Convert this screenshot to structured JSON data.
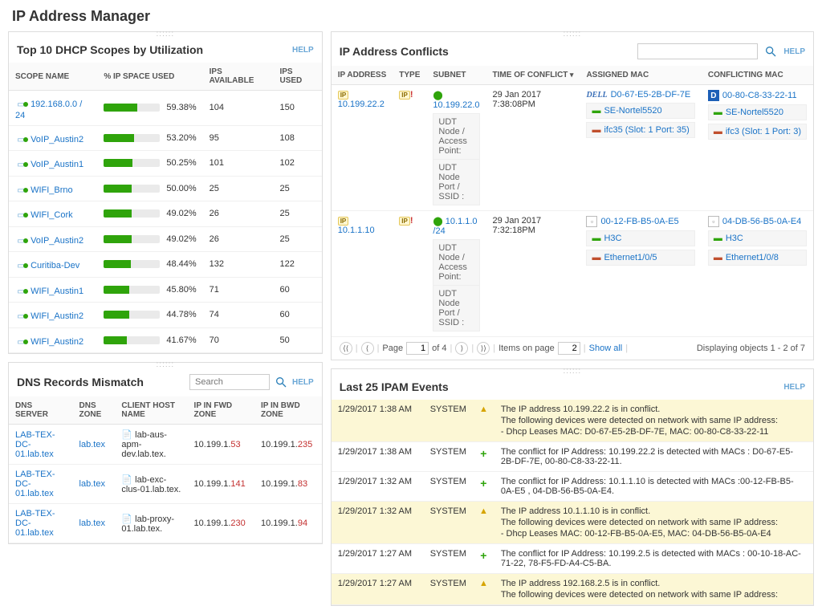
{
  "page_title": "IP Address Manager",
  "help_label": "HELP",
  "dhcp": {
    "title": "Top 10 DHCP Scopes by Utilization",
    "cols": {
      "name": "SCOPE NAME",
      "used": "% IP SPACE USED",
      "avail": "IPS AVAILABLE",
      "ipsused": "IPS USED"
    },
    "rows": [
      {
        "name": "192.168.0.0 / 24",
        "pct": 59.38,
        "pct_label": "59.38%",
        "avail": 104,
        "used": 150
      },
      {
        "name": "VoIP_Austin2",
        "pct": 53.2,
        "pct_label": "53.20%",
        "avail": 95,
        "used": 108
      },
      {
        "name": "VoIP_Austin1",
        "pct": 50.25,
        "pct_label": "50.25%",
        "avail": 101,
        "used": 102
      },
      {
        "name": "WIFI_Brno",
        "pct": 50.0,
        "pct_label": "50.00%",
        "avail": 25,
        "used": 25
      },
      {
        "name": "WIFI_Cork",
        "pct": 49.02,
        "pct_label": "49.02%",
        "avail": 26,
        "used": 25
      },
      {
        "name": "VoIP_Austin2",
        "pct": 49.02,
        "pct_label": "49.02%",
        "avail": 26,
        "used": 25
      },
      {
        "name": "Curitiba-Dev",
        "pct": 48.44,
        "pct_label": "48.44%",
        "avail": 132,
        "used": 122
      },
      {
        "name": "WIFI_Austin1",
        "pct": 45.8,
        "pct_label": "45.80%",
        "avail": 71,
        "used": 60
      },
      {
        "name": "WIFI_Austin2",
        "pct": 44.78,
        "pct_label": "44.78%",
        "avail": 74,
        "used": 60
      },
      {
        "name": "WIFI_Austin2",
        "pct": 41.67,
        "pct_label": "41.67%",
        "avail": 70,
        "used": 50
      }
    ]
  },
  "dns": {
    "title": "DNS Records Mismatch",
    "search_placeholder": "Search",
    "cols": {
      "server": "DNS SERVER",
      "zone": "DNS ZONE",
      "host": "CLIENT HOST NAME",
      "fwd": "IP IN FWD ZONE",
      "bwd": "IP IN BWD ZONE"
    },
    "rows": [
      {
        "server": "LAB-TEX-DC-01.lab.tex",
        "zone": "lab.tex",
        "host": "lab-aus-apm-dev.lab.tex.",
        "fwd_pre": "10.199.1.",
        "fwd_suf": "53",
        "bwd_pre": "10.199.1.",
        "bwd_suf": "235"
      },
      {
        "server": "LAB-TEX-DC-01.lab.tex",
        "zone": "lab.tex",
        "host": "lab-exc-clus-01.lab.tex.",
        "fwd_pre": "10.199.1.",
        "fwd_suf": "141",
        "bwd_pre": "10.199.1.",
        "bwd_suf": "83"
      },
      {
        "server": "LAB-TEX-DC-01.lab.tex",
        "zone": "lab.tex",
        "host": "lab-proxy-01.lab.tex.",
        "fwd_pre": "10.199.1.",
        "fwd_suf": "230",
        "bwd_pre": "10.199.1.",
        "bwd_suf": "94"
      }
    ]
  },
  "conflicts": {
    "title": "IP Address Conflicts",
    "cols": {
      "ip": "IP ADDRESS",
      "type": "TYPE",
      "subnet": "SUBNET",
      "time": "TIME OF CONFLICT",
      "assigned": "ASSIGNED MAC",
      "conflicting": "CONFLICTING MAC"
    },
    "sublabels": {
      "udt_ap": "UDT Node / Access Point:",
      "udt_port": "UDT Node Port / SSID :"
    },
    "rows": [
      {
        "ip": "10.199.22.2",
        "subnet": "10.199.22.0",
        "time_l1": "29 Jan 2017",
        "time_l2": "7:38:08PM",
        "assigned": {
          "mac": "D0-67-E5-2B-DF-7E",
          "brand": "dell",
          "node": "SE-Nortel5520",
          "port": "ifc35 (Slot: 1 Port: 35)"
        },
        "conflicting": {
          "mac": "00-80-C8-33-22-11",
          "brand": "D",
          "node": "SE-Nortel5520",
          "port": "ifc3 (Slot: 1 Port: 3)"
        }
      },
      {
        "ip": "10.1.1.10",
        "subnet": "10.1.1.0 /24",
        "time_l1": "29 Jan 2017",
        "time_l2": "7:32:18PM",
        "assigned": {
          "mac": "00-12-FB-B5-0A-E5",
          "brand": "box",
          "node": "H3C",
          "port": "Ethernet1/0/5"
        },
        "conflicting": {
          "mac": "04-DB-56-B5-0A-E4",
          "brand": "box",
          "node": "H3C",
          "port": "Ethernet1/0/8"
        }
      }
    ],
    "pager": {
      "page": "1",
      "of": "of 4",
      "items_label": "Items on page",
      "items": "2",
      "showall": "Show all",
      "display": "Displaying objects 1 - 2 of 7",
      "page_label": "Page"
    }
  },
  "events": {
    "title": "Last 25 IPAM Events",
    "rows": [
      {
        "warn": true,
        "date": "1/29/2017 1:38 AM",
        "src": "SYSTEM",
        "msg": "The IP address 10.199.22.2 is in conflict.\nThe following devices were detected on network with same IP address:\n- Dhcp Leases MAC: D0-67-E5-2B-DF-7E, MAC: 00-80-C8-33-22-11"
      },
      {
        "warn": false,
        "date": "1/29/2017 1:38 AM",
        "src": "SYSTEM",
        "msg": "The conflict for IP Address: 10.199.22.2 is detected with MACs : D0-67-E5-2B-DF-7E, 00-80-C8-33-22-11."
      },
      {
        "warn": false,
        "date": "1/29/2017 1:32 AM",
        "src": "SYSTEM",
        "msg": "The conflict for IP Address: 10.1.1.10 is detected with MACs :00-12-FB-B5-0A-E5 , 04-DB-56-B5-0A-E4."
      },
      {
        "warn": true,
        "date": "1/29/2017 1:32 AM",
        "src": "SYSTEM",
        "msg": "The IP address 10.1.1.10 is in conflict.\nThe following devices were detected on network with same IP address:\n- Dhcp Leases MAC: 00-12-FB-B5-0A-E5, MAC: 04-DB-56-B5-0A-E4"
      },
      {
        "warn": false,
        "date": "1/29/2017 1:27 AM",
        "src": "SYSTEM",
        "msg": "The conflict for IP Address: 10.199.2.5 is detected with MACs : 00-10-18-AC-71-22, 78-F5-FD-A4-C5-BA."
      },
      {
        "warn": true,
        "date": "1/29/2017 1:27 AM",
        "src": "SYSTEM",
        "msg": "The IP address 192.168.2.5 is in conflict.\nThe following devices were detected on network with same IP address:"
      }
    ]
  }
}
